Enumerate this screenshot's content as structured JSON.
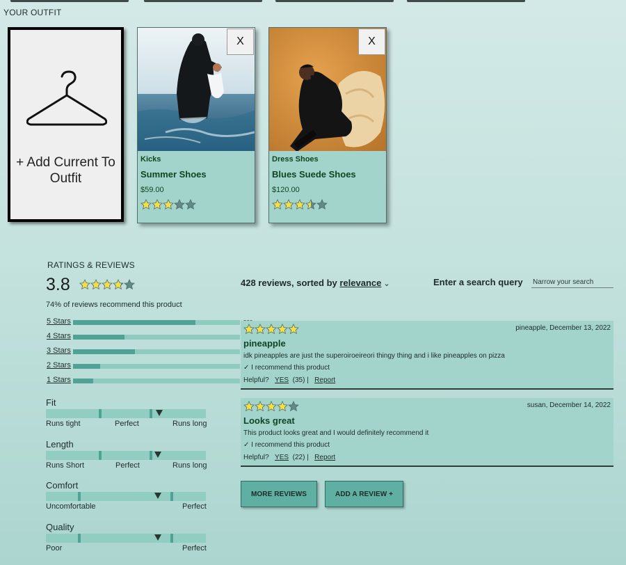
{
  "outfit": {
    "title": "YOUR OUTFIT",
    "add_card_label": "+ Add Current To Outfit",
    "items": [
      {
        "category": "Kicks",
        "name": "Summer Shoes",
        "price": "$59.00",
        "rating": 3,
        "remove_label": "X"
      },
      {
        "category": "Dress Shoes",
        "name": "Blues Suede Shoes",
        "price": "$120.00",
        "rating": 3.5,
        "remove_label": "X"
      }
    ]
  },
  "ratings": {
    "title": "RATINGS & REVIEWS",
    "average": "3.8",
    "average_value": 3.8,
    "recommend_text": "74% of reviews recommend this product",
    "breakdown": [
      {
        "label": "5 Stars",
        "count": "580",
        "value": 580
      },
      {
        "label": "4 Stars",
        "count": "245",
        "value": 245
      },
      {
        "label": "3 Stars",
        "count": "294",
        "value": 294
      },
      {
        "label": "2 Stars",
        "count": "130",
        "value": 130
      },
      {
        "label": "1 Stars",
        "count": "96",
        "value": 96
      }
    ],
    "characteristics": [
      {
        "name": "Fit",
        "low": "Runs tight",
        "mid": "Perfect",
        "high": "Runs long",
        "value": 0.71
      },
      {
        "name": "Length",
        "low": "Runs Short",
        "mid": "Perfect",
        "high": "Runs long",
        "value": 0.7
      },
      {
        "name": "Comfort",
        "low": "Uncomfortable",
        "mid": "",
        "high": "Perfect",
        "value": 0.7
      },
      {
        "name": "Quality",
        "low": "Poor",
        "mid": "",
        "high": "Perfect",
        "value": 0.7
      }
    ]
  },
  "reviews": {
    "summary_prefix": "428 reviews, sorted by ",
    "sort_value": "relevance",
    "search_label": "Enter a search query",
    "search_placeholder": "Narrow your search",
    "items": [
      {
        "rating": 5,
        "meta": "pineapple, December 13, 2022",
        "title": "pineapple",
        "body": "idk pineapples are just the superoiroeireori thingy thing and i like pineapples on pizza",
        "recommend": "✓ I recommend this product",
        "helpful_label": "Helpful?",
        "yes_label": "YES",
        "helpful_count": "(35)",
        "separator": "|",
        "report_label": "Report"
      },
      {
        "rating": 4,
        "meta": "susan, December 14, 2022",
        "title": "Looks great",
        "body": "This product looks great and I would definitely recommend it",
        "recommend": "✓ I recommend this product",
        "helpful_label": "Helpful?",
        "yes_label": "YES",
        "helpful_count": "(22)",
        "separator": "|",
        "report_label": "Report"
      }
    ],
    "more_label": "MORE REVIEWS",
    "add_label": "ADD A REVIEW +"
  },
  "colors": {
    "star_fill": "#f5de4a",
    "star_empty": "#5f8a86",
    "card_bg": "#a3d4cb",
    "bar_fill": "#4fa294",
    "button_bg": "#5fb0a2"
  }
}
